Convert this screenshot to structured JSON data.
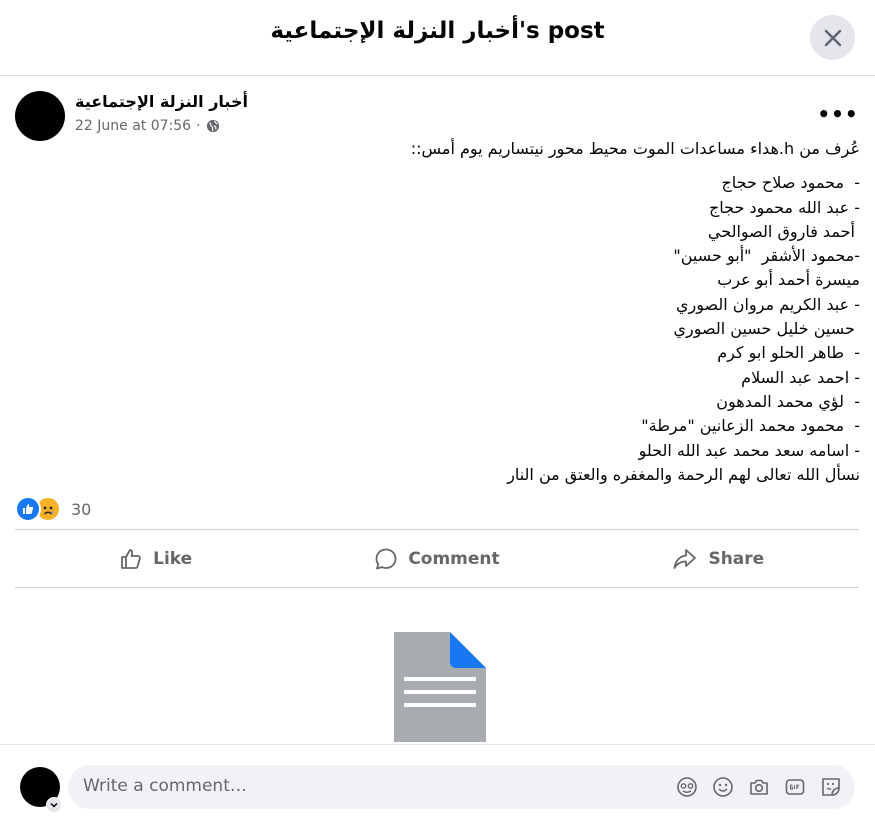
{
  "header": {
    "title": "أخبار النزلة الإجتماعية's post"
  },
  "post": {
    "page_name": "أخبار النزلة الإجتماعية",
    "timestamp": "22 June at 07:56",
    "intro": "عُرف من h.هداء مساعدات الموت محيط محور نيتساريم يوم أمس::",
    "names": [
      "-  محمود صلاح حجاج",
      "- عبد الله محمود حجاج",
      " أحمد فاروق الصوالحي",
      "-محمود الأشقر  \"أبو حسين\"",
      "ميسرة أحمد أبو عرب",
      "- عبد الكريم مروان الصوري",
      " حسين خليل حسين الصوري",
      "-  طاهر الحلو ابو كرم",
      "- احمد عبد السلام",
      "-  لؤي محمد المدهون",
      "-  محمود محمد الزعانين \"مرطة\"",
      "- اسامه سعد محمد عبد الله الحلو",
      "نسأل الله تعالى لهم الرحمة والمغفره والعتق من النار"
    ]
  },
  "reactions": {
    "count": "30"
  },
  "actions": {
    "like": "Like",
    "comment": "Comment",
    "share": "Share"
  },
  "comment_box": {
    "placeholder": "Write a comment…"
  },
  "colors": {
    "accent": "#1877f2",
    "muted_text": "#65676b",
    "sad_emoji": "#f7b125"
  }
}
